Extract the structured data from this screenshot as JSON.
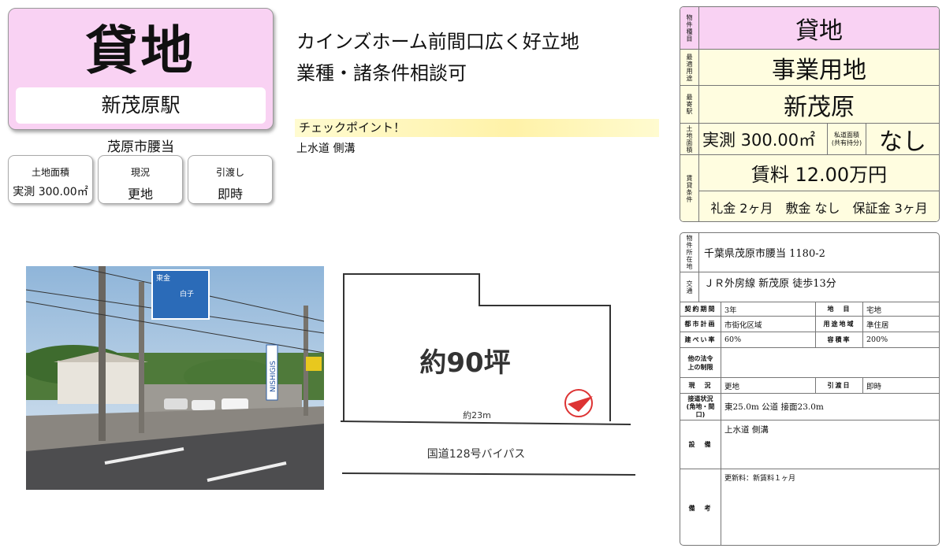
{
  "header": {
    "type": "貸地",
    "station": "新茂原駅",
    "city": "茂原市腰当"
  },
  "summary": [
    {
      "label": "土地面積",
      "value": "実測 300.00㎡"
    },
    {
      "label": "現況",
      "value": "更地"
    },
    {
      "label": "引渡し",
      "value": "即時"
    }
  ],
  "catch": {
    "line1": "カインズホーム前間口広く好立地",
    "line2": "業種・諸条件相談可"
  },
  "checkpoint": {
    "title": "チェックポイント！",
    "value": "上水道 側溝"
  },
  "plan": {
    "area": "約90坪",
    "frontage": "約23m",
    "road": "国道128号バイパス"
  },
  "photo": {
    "sign_top": "東金",
    "sign_right": "白子",
    "store_sign": "NISHIGIS"
  },
  "spec": {
    "type_label": "物件種目",
    "type": "貸地",
    "use_label": "最適用途",
    "use": "事業用地",
    "station_label": "最寄駅",
    "station": "新茂原",
    "area_label": "土地面積",
    "area": "実測 300.00㎡",
    "private_road_label": "私道面積\n(共有持分)",
    "private_road": "なし",
    "rent_label": "賃貸条件",
    "rent": "賃料 12.00万円",
    "deposits": "礼金 2ヶ月　敷金 なし　保証金 3ヶ月"
  },
  "details": {
    "address_label": "物件所在地",
    "address": "千葉県茂原市腰当 1180-2",
    "traffic_label": "交通",
    "traffic": "ＪＲ外房線 新茂原 徒歩13分",
    "contract_label": "契約期間",
    "contract": "3年",
    "landcat_label": "地　目",
    "landcat": "宅地",
    "cityplan_label": "都市計画",
    "cityplan": "市街化区域",
    "zoning_label": "用途地域",
    "zoning": "準住居",
    "bcr_label": "建ぺい率",
    "bcr": "60%",
    "far_label": "容積率",
    "far": "200%",
    "otherlaw_label": "他の法令上の制限",
    "otherlaw": "",
    "status_label": "現　況",
    "status": "更地",
    "handover_label": "引渡日",
    "handover": "即時",
    "road_label": "接道状況(角地・間口)",
    "road": "東25.0m 公道 接面23.0m",
    "facility_label": "設　備",
    "facility": "上水道 側溝",
    "remarks_label": "備　考",
    "remarks": "更新料：新賃料１ヶ月"
  }
}
